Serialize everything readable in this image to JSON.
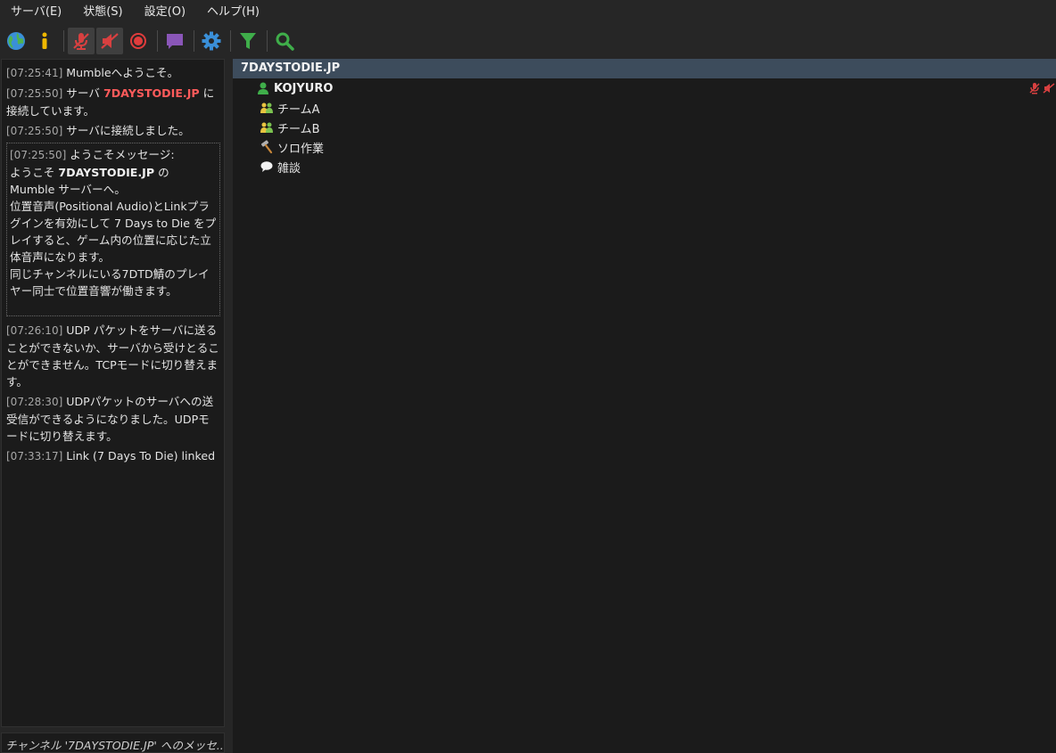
{
  "menu": [
    "サーバ(E)",
    "状態(S)",
    "設定(O)",
    "ヘルプ(H)"
  ],
  "toolbar": {
    "buttons": [
      {
        "icon": "globe-icon"
      },
      {
        "icon": "info-icon"
      },
      {
        "icon": "mic-muted-icon",
        "active": true
      },
      {
        "icon": "speaker-deafened-icon",
        "active": true
      },
      {
        "icon": "record-icon"
      },
      {
        "icon": "chat-icon"
      },
      {
        "icon": "gear-icon"
      },
      {
        "icon": "filter-icon"
      },
      {
        "icon": "search-icon"
      }
    ]
  },
  "log": {
    "e1": {
      "ts": "[07:25:41]",
      "text": " Mumbleへようこそ。"
    },
    "e2": {
      "ts": "[07:25:50]",
      "pre": " サーバ ",
      "server": "7DAYSTODIE.JP",
      "post": " に接続しています。"
    },
    "e3": {
      "ts": "[07:25:50]",
      "text": " サーバに接続しました。"
    },
    "welcome": {
      "ts": "[07:25:50]",
      "head": " ようこそメッセージ:",
      "line1_pre": "ようこそ ",
      "line1_server": "7DAYSTODIE.JP",
      "line1_post": " の Mumble サーバーへ。",
      "line2": "位置音声(Positional Audio)とLinkプラグインを有効にして 7 Days to Die をプレイすると、ゲーム内の位置に応じた立体音声になります。",
      "line3": "同じチャンネルにいる7DTD鯖のプレイヤー同士で位置音響が働きます。"
    },
    "e4": {
      "ts": "[07:26:10]",
      "text": " UDP パケットをサーバに送ることができないか、サーバから受けとることができません。TCPモードに切り替えます。"
    },
    "e5": {
      "ts": "[07:28:30]",
      "text": " UDPパケットのサーバへの送受信ができるようになりました。UDPモードに切り替えます。"
    },
    "e6": {
      "ts": "[07:33:17]",
      "text": " Link (7 Days To Die) linked"
    }
  },
  "chat_input": {
    "placeholder": "チャンネル '7DAYSTODIE.JP' へのメッセ..."
  },
  "tree": {
    "root": "7DAYSTODIE.JP",
    "user": {
      "name": "KOJYURO",
      "icon": "user-icon",
      "flags": [
        "mic-muted-icon",
        "speaker-deafened-icon"
      ]
    },
    "channels": [
      {
        "name": "チームA",
        "icon": "team-icon"
      },
      {
        "name": "チームB",
        "icon": "team-icon"
      },
      {
        "name": "ソロ作業",
        "icon": "hammer-icon"
      },
      {
        "name": "雑談",
        "icon": "speech-bubble-icon"
      }
    ]
  },
  "colors": {
    "server_name": "#ff5b5b",
    "root_bg": "#3d4c5c",
    "pane_bg": "#1b1b1b"
  }
}
